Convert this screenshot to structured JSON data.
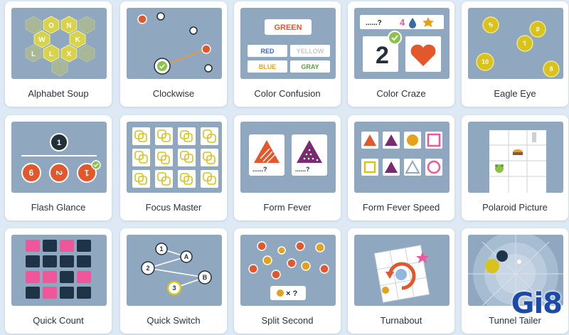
{
  "games": [
    {
      "label": "Alphabet Soup",
      "letters": [
        "O",
        "N",
        "W",
        "K",
        "L",
        "X",
        "L"
      ]
    },
    {
      "label": "Clockwise"
    },
    {
      "label": "Color Confusion",
      "words": [
        "GREEN",
        "RED",
        "YELLOW",
        "BLUE",
        "GRAY"
      ]
    },
    {
      "label": "Color Craze",
      "question": "......?",
      "digit_a": "4",
      "digit_b": "2"
    },
    {
      "label": "Eagle Eye",
      "numbers": [
        "5",
        "9",
        "7",
        "10",
        "8"
      ]
    },
    {
      "label": "Flash Glance",
      "numbers": [
        "1",
        "6",
        "2",
        "1"
      ]
    },
    {
      "label": "Focus Master"
    },
    {
      "label": "Form Fever",
      "question_a": "......?",
      "question_b": "......?"
    },
    {
      "label": "Form Fever Speed"
    },
    {
      "label": "Polaroid Picture"
    },
    {
      "label": "Quick Count"
    },
    {
      "label": "Quick Switch",
      "nodes": [
        "1",
        "2",
        "3",
        "A",
        "B"
      ]
    },
    {
      "label": "Split Second",
      "expression": "× ?"
    },
    {
      "label": "Turnabout"
    },
    {
      "label": "Tunnel Tailer"
    }
  ],
  "watermark": "Gi8",
  "colors": {
    "thumb_bg": "#8fa8bf",
    "accent_orange": "#e2572b",
    "accent_yellow": "#d9c21b",
    "accent_pink": "#f0579b",
    "dark_navy": "#1f3347"
  }
}
